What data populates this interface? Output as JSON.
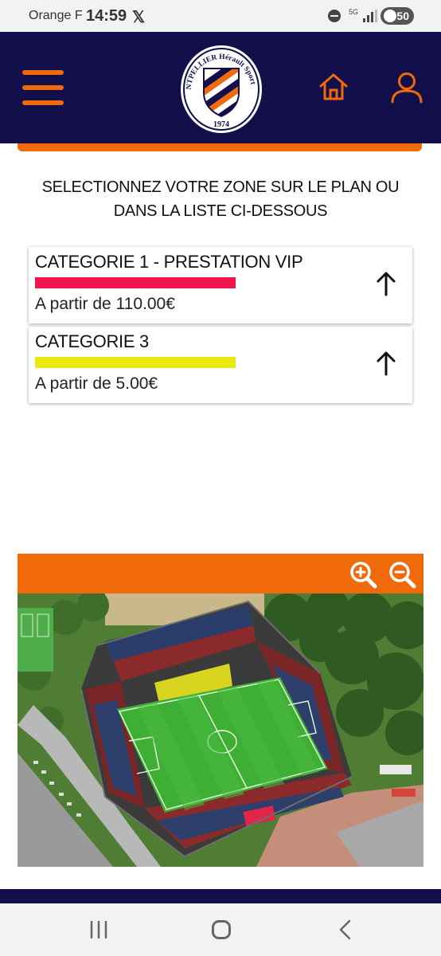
{
  "status_bar": {
    "carrier": "Orange F",
    "time": "14:59",
    "x_app_icon": "x-logo-icon",
    "dnd_icon": "do-not-disturb-icon",
    "network": "5G",
    "signal_icon": "signal-icon",
    "battery": "50"
  },
  "header": {
    "menu_icon": "hamburger-menu-icon",
    "logo_text_top": "MONTPELLIER Hérault Sport Club",
    "logo_year": "1974",
    "home_icon": "home-icon",
    "account_icon": "user-icon"
  },
  "instruction": {
    "line1": "SELECTIONNEZ VOTRE ZONE SUR LE PLAN OU",
    "line2": "DANS LA LISTE CI-DESSOUS"
  },
  "categories": [
    {
      "name": "CATEGORIE 1 - PRESTATION VIP",
      "color": "#f0144a",
      "price": "A partir de 110.00€",
      "icon": "arrow-up-icon"
    },
    {
      "name": "CATEGORIE 3",
      "color": "#eaea10",
      "price": "A partir de 5.00€",
      "icon": "arrow-up-icon"
    }
  ],
  "map": {
    "toolbar_color": "#f06a0c",
    "zoom_in_icon": "zoom-in-icon",
    "zoom_out_icon": "zoom-out-icon"
  },
  "colors": {
    "brand_navy": "#120f4a",
    "brand_orange": "#f06a0c"
  },
  "nav_bar": {
    "recents_icon": "recent-apps-icon",
    "home_icon": "home-circle-icon",
    "back_icon": "back-icon"
  }
}
